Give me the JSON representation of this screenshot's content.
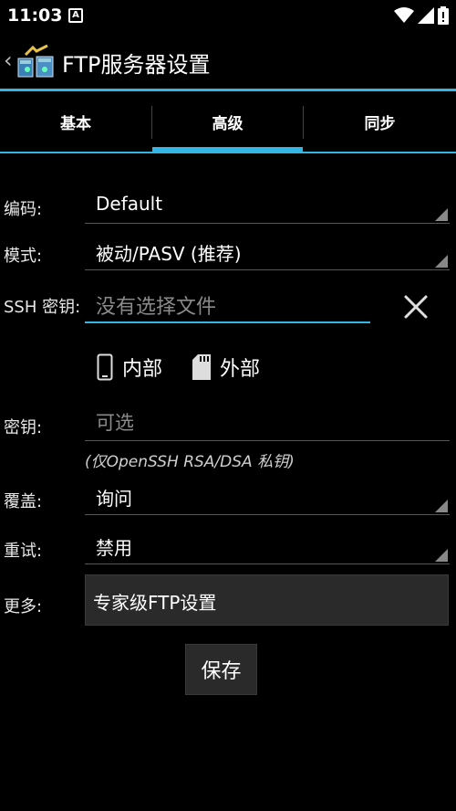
{
  "status": {
    "time": "11:03",
    "notif_letter": "A"
  },
  "app": {
    "title": "FTP服务器设置",
    "back_glyph": "‹"
  },
  "tabs": [
    {
      "label": "基本"
    },
    {
      "label": "高级",
      "selected": true
    },
    {
      "label": "同步"
    }
  ],
  "form": {
    "encoding": {
      "label": "编码:",
      "value": "Default"
    },
    "mode": {
      "label": "模式:",
      "value": "被动/PASV (推荐)"
    },
    "ssh_key": {
      "label": "SSH 密钥:",
      "placeholder": "没有选择文件"
    },
    "storage": {
      "internal": "内部",
      "external": "外部"
    },
    "passphrase": {
      "label": "密钥:",
      "placeholder": "可选"
    },
    "hint": "(仅OpenSSH RSA/DSA 私钥)",
    "overwrite": {
      "label": "覆盖:",
      "value": "询问"
    },
    "retry": {
      "label": "重试:",
      "value": "禁用"
    },
    "more": {
      "label": "更多:",
      "button": "专家级FTP设置"
    },
    "save": "保存"
  },
  "colors": {
    "accent": "#33b5e5",
    "background": "#000000",
    "button": "#2a2a2a"
  },
  "icons": [
    "back-chevron-icon",
    "ftp-app-icon",
    "clear-icon",
    "phone-icon",
    "sd-card-icon",
    "wifi-icon",
    "signal-icon",
    "battery-icon"
  ]
}
